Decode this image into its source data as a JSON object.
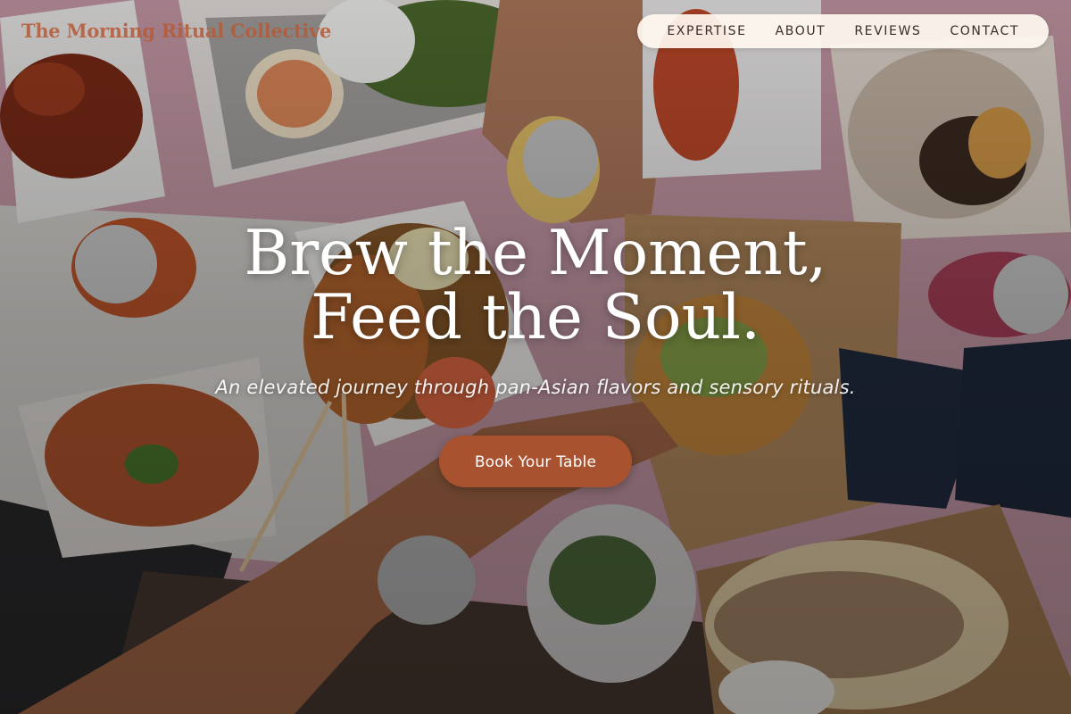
{
  "brand": {
    "name": "The Morning Ritual Collective",
    "color": "#b65a37"
  },
  "nav": {
    "items": [
      {
        "label": "EXPERTISE"
      },
      {
        "label": "ABOUT"
      },
      {
        "label": "REVIEWS"
      },
      {
        "label": "CONTACT"
      }
    ]
  },
  "hero": {
    "headline": "Brew the Moment, Feed the Soul.",
    "tagline": "An elevated journey through pan-Asian flavors and sensory rituals.",
    "cta_label": "Book Your Table",
    "cta_color": "#a9522f",
    "background_image": "overhead-food-table-photo"
  }
}
